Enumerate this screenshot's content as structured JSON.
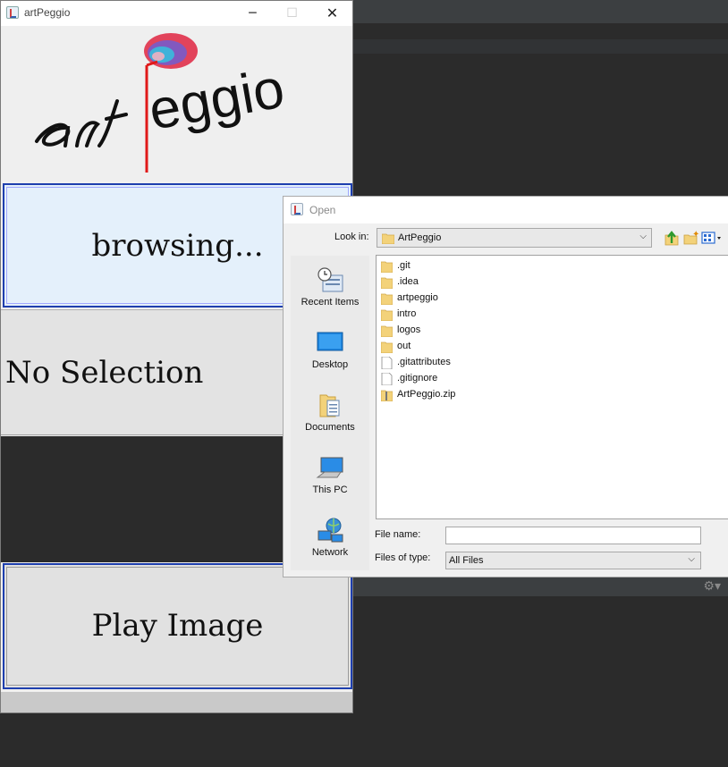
{
  "main_window": {
    "title": "artPeggio",
    "logo_alt": "artPeggio",
    "browse_button": "browsing...",
    "selection_status": "No Selection",
    "play_button": "Play Image"
  },
  "open_dialog": {
    "title": "Open",
    "look_in_label": "Look in:",
    "look_in_value": "ArtPeggio",
    "places": [
      {
        "label": "Recent Items",
        "icon": "recent-items-icon"
      },
      {
        "label": "Desktop",
        "icon": "desktop-icon"
      },
      {
        "label": "Documents",
        "icon": "documents-icon"
      },
      {
        "label": "This PC",
        "icon": "this-pc-icon"
      },
      {
        "label": "Network",
        "icon": "network-icon"
      }
    ],
    "files": [
      {
        "name": ".git",
        "type": "folder"
      },
      {
        "name": ".idea",
        "type": "folder"
      },
      {
        "name": "artpeggio",
        "type": "folder"
      },
      {
        "name": "intro",
        "type": "folder"
      },
      {
        "name": "logos",
        "type": "folder"
      },
      {
        "name": "out",
        "type": "folder"
      },
      {
        "name": ".gitattributes",
        "type": "file"
      },
      {
        "name": ".gitignore",
        "type": "file"
      },
      {
        "name": "ArtPeggio.zip",
        "type": "zip"
      }
    ],
    "file_name_label": "File name:",
    "file_name_value": "",
    "files_of_type_label": "Files of type:",
    "files_of_type_value": "All Files"
  },
  "colors": {
    "button_border": "#1e3fae",
    "browse_bg": "#e4f0fb",
    "ide_bg": "#2b2b2b"
  }
}
